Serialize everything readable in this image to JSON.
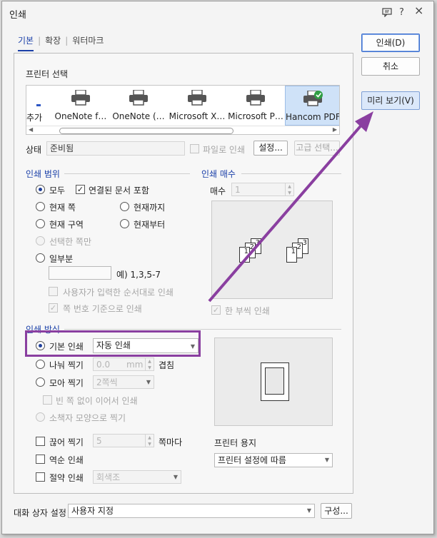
{
  "title": "인쇄",
  "titlebar_icons": {
    "help": "?",
    "close": "×"
  },
  "tabs": [
    {
      "label": "기본"
    },
    {
      "label": "확장"
    },
    {
      "label": "워터마크"
    }
  ],
  "right_buttons": {
    "print": "인쇄(D)",
    "cancel": "취소",
    "preview": "미리 보기(V)"
  },
  "printer_select": {
    "heading": "프린터 선택",
    "items": [
      {
        "label": "추가"
      },
      {
        "label": "OneNote f…"
      },
      {
        "label": "OneNote (…"
      },
      {
        "label": "Microsoft X…"
      },
      {
        "label": "Microsoft P…"
      },
      {
        "label": "Hancom PDF"
      }
    ],
    "selected": "Hancom PDF"
  },
  "status": {
    "label": "상태",
    "value": "준비됨",
    "print_to_file": "파일로 인쇄",
    "settings_button": "설정...",
    "advanced_button": "고급 선택..."
  },
  "range": {
    "heading": "인쇄 범위",
    "all": "모두",
    "include_linked": "연결된 문서 포함",
    "current_page": "현재 쪽",
    "until_current": "현재까지",
    "current_section": "현재 구역",
    "from_current": "현재부터",
    "selected_only": "선택한 쪽만",
    "partial": "일부분",
    "example": "예) 1,3,5-7",
    "user_order": "사용자가 입력한 순서대로 인쇄",
    "page_number_basis": "쪽 번호 기준으로 인쇄"
  },
  "copies": {
    "heading": "인쇄 매수",
    "label": "매수",
    "value": "1",
    "collate": "한 부씩 인쇄",
    "sheet1": [
      "1",
      "2",
      "3"
    ],
    "sheet2": [
      "1",
      "2",
      "3"
    ]
  },
  "method": {
    "heading": "인쇄 방식",
    "basic": "기본 인쇄",
    "basic_option": "자동 인쇄",
    "split": "나눠 찍기",
    "split_value": "0.0",
    "split_unit": "mm",
    "overlap": "겹침",
    "collect": "모아 찍기",
    "collect_option": "2쪽씩",
    "no_blank": "빈 쪽 없이 이어서 인쇄",
    "booklet": "소책자 모양으로 찍기",
    "cut": "끊어 찍기",
    "cut_value": "5",
    "per_page": "쪽마다",
    "reverse": "역순 인쇄",
    "economy": "절약 인쇄",
    "economy_option": "회색조"
  },
  "paper": {
    "heading": "프린터 용지",
    "option": "프린터 설정에 따름"
  },
  "dialog_settings": {
    "label": "대화 상자 설정",
    "option": "사용자 지정",
    "button": "구성..."
  },
  "accent_color": "#8a3fa0"
}
